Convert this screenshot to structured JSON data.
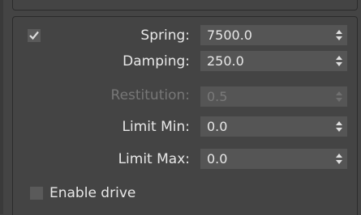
{
  "enabled_checkbox": {
    "checked": true
  },
  "params": [
    {
      "label": "Spring:",
      "value": "7500.0",
      "disabled": false
    },
    {
      "label": "Damping:",
      "value": "250.0",
      "disabled": false
    },
    {
      "label": "Restitution:",
      "value": "0.5",
      "disabled": true
    },
    {
      "label": "Limit Min:",
      "value": "0.0",
      "disabled": false
    },
    {
      "label": "Limit Max:",
      "value": "0.0",
      "disabled": false
    }
  ],
  "enable_drive": {
    "label": "Enable drive",
    "checked": false
  },
  "colors": {
    "background": "#444444",
    "field": "#555555",
    "text": "#e8e8e8",
    "disabled_text": "#777777"
  }
}
